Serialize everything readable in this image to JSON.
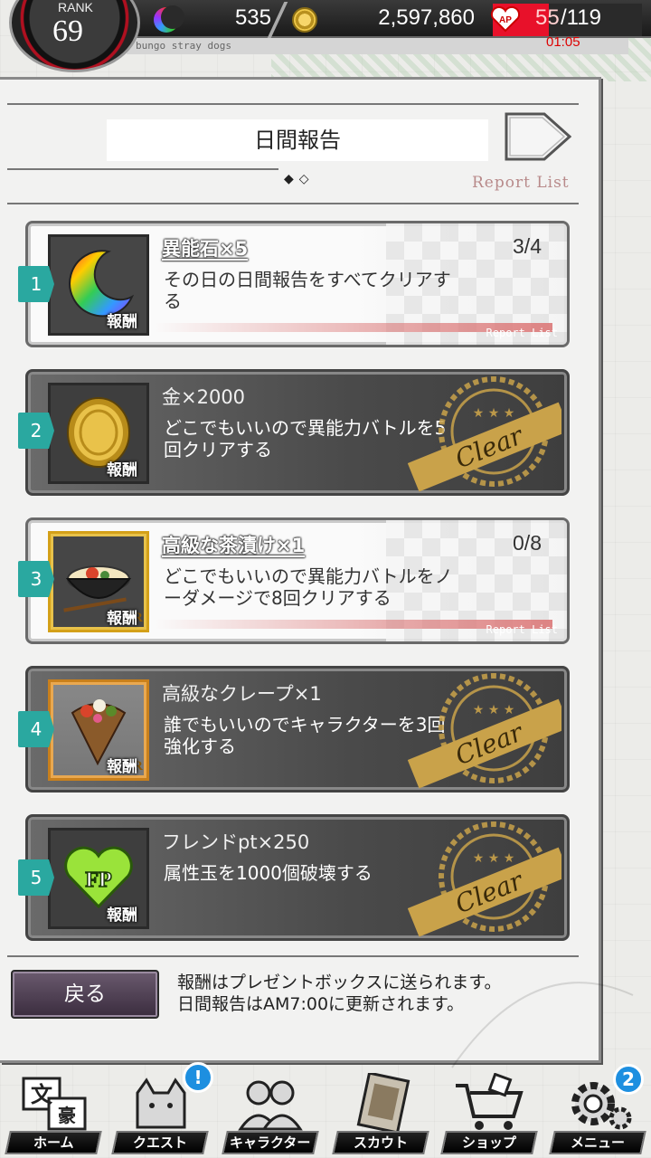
{
  "header": {
    "rank_label": "RANK",
    "rank_value": "69",
    "ability_stones": "535",
    "coins": "2,597,860",
    "ap_current": "55",
    "ap_max": "/119",
    "ap_timer": "01:05",
    "game_tag": "bungo stray dogs"
  },
  "page": {
    "title": "日間報告",
    "page_dots": "◆◇",
    "report_list_label": "Report List"
  },
  "missions": [
    {
      "number": "1",
      "reward_name": "異能石×5",
      "description": "その日の日間報告をすべてクリアする",
      "progress": "3/4",
      "reward_label": "報酬",
      "report_link": "Report List",
      "state": "in-progress",
      "icon": "crescent-stone-icon"
    },
    {
      "number": "2",
      "reward_name": "金×2000",
      "description": "どこでもいいので異能力バトルを5回クリアする",
      "reward_label": "報酬",
      "state": "cleared",
      "clear_text": "Clear",
      "icon": "gold-coin-icon"
    },
    {
      "number": "3",
      "reward_name": "高級な茶漬け×1",
      "description": "どこでもいいので異能力バトルをノーダメージで8回クリアする",
      "progress": "0/8",
      "reward_label": "報酬",
      "rarity": "SR",
      "report_link": "Report List",
      "state": "in-progress",
      "icon": "ochazuke-bowl-icon"
    },
    {
      "number": "4",
      "reward_name": "高級なクレープ×1",
      "description": "誰でもいいのでキャラクターを3回強化する",
      "reward_label": "報酬",
      "rarity": "R",
      "state": "cleared",
      "clear_text": "Clear",
      "icon": "crepe-icon"
    },
    {
      "number": "5",
      "reward_name": "フレンドpt×250",
      "description": "属性玉を1000個破壊する",
      "reward_label": "報酬",
      "state": "cleared",
      "clear_text": "Clear",
      "icon": "friend-point-heart-icon",
      "icon_text": "FP"
    }
  ],
  "footer": {
    "back_label": "戻る",
    "note_line1": "報酬はプレゼントボックスに送られます。",
    "note_line2": "日間報告はAM7:00に更新されます。"
  },
  "nav": {
    "items": [
      {
        "label": "ホーム",
        "icon": "home-kanji-icon"
      },
      {
        "label": "クエスト",
        "icon": "quest-cat-icon",
        "alert": "!"
      },
      {
        "label": "キャラクター",
        "icon": "characters-icon"
      },
      {
        "label": "スカウト",
        "icon": "scout-book-icon"
      },
      {
        "label": "ショップ",
        "icon": "shop-cart-icon"
      },
      {
        "label": "メニュー",
        "icon": "menu-gear-icon",
        "badge": "2"
      }
    ]
  },
  "colors": {
    "accent_teal": "#2aa8a0",
    "ap_red": "#e8112a",
    "badge_blue": "#1d8fe0",
    "clear_gold": "#c9a24a"
  }
}
